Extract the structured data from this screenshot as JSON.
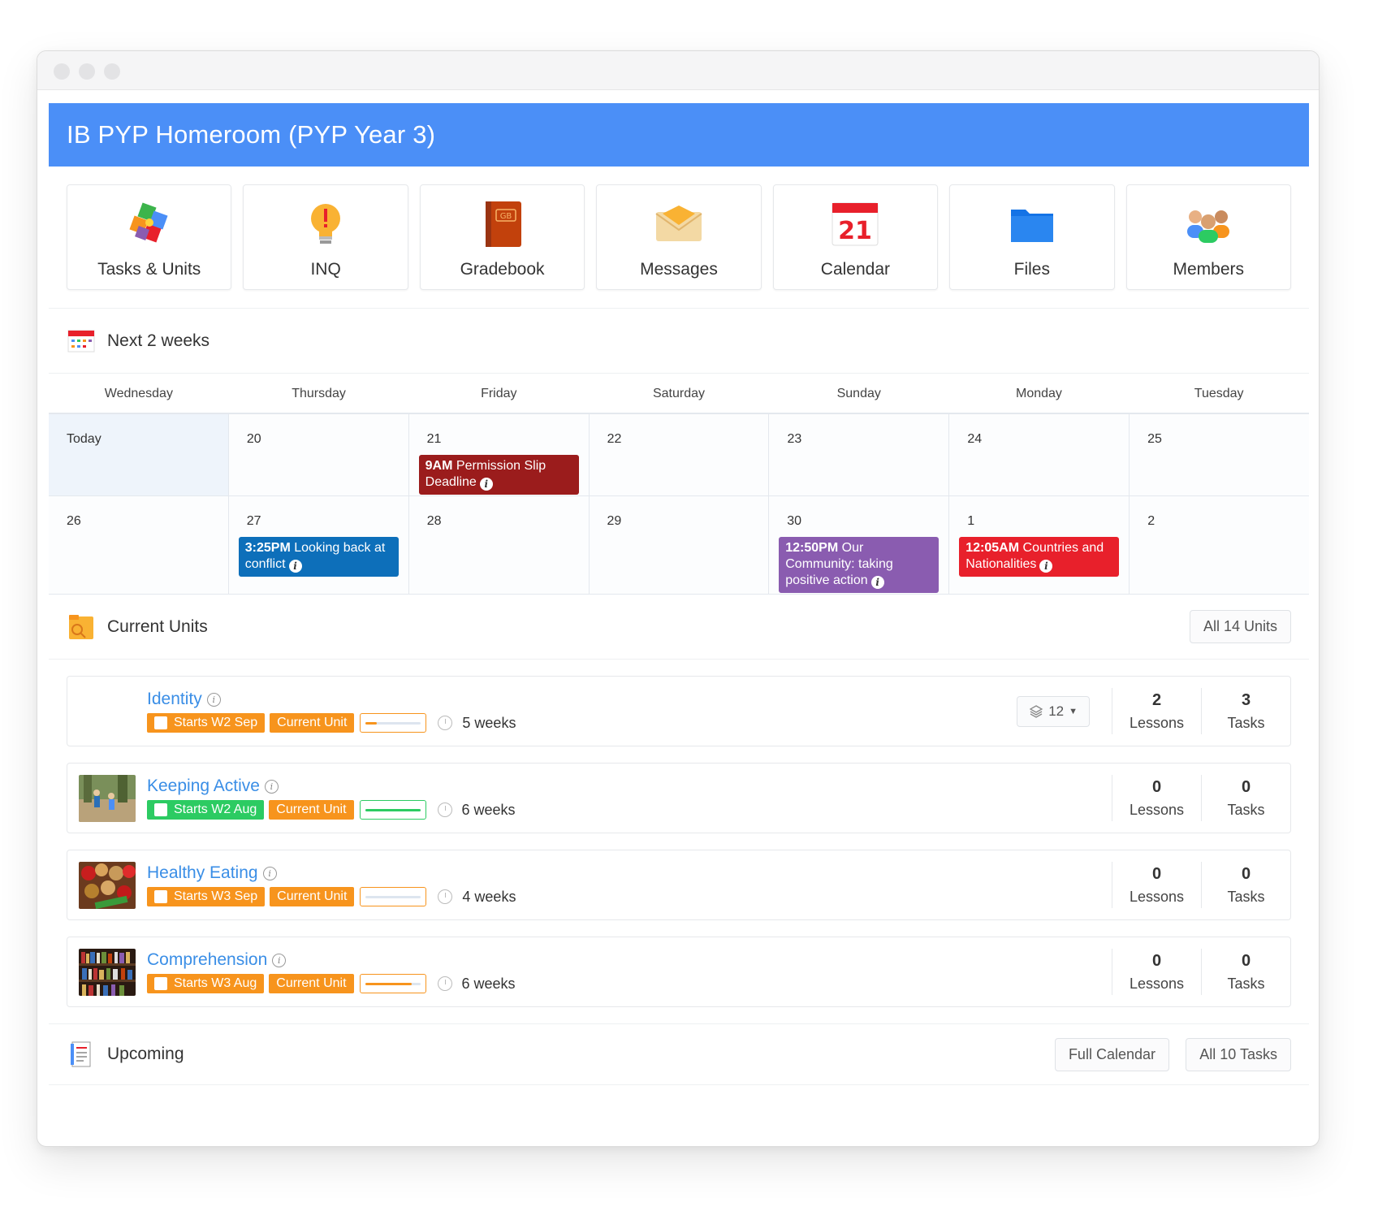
{
  "page": {
    "title": "IB PYP Homeroom (PYP Year 3)"
  },
  "tools": [
    {
      "label": "Tasks & Units",
      "icon": "puzzle-icon"
    },
    {
      "label": "INQ",
      "icon": "lightbulb-icon"
    },
    {
      "label": "Gradebook",
      "icon": "gradebook-icon"
    },
    {
      "label": "Messages",
      "icon": "envelope-icon"
    },
    {
      "label": "Calendar",
      "icon": "calendar-icon"
    },
    {
      "label": "Files",
      "icon": "folder-icon"
    },
    {
      "label": "Members",
      "icon": "members-icon"
    }
  ],
  "calendar_icon_day": "21",
  "next_weeks": {
    "title": "Next 2 weeks",
    "days": [
      "Wednesday",
      "Thursday",
      "Friday",
      "Saturday",
      "Sunday",
      "Monday",
      "Tuesday"
    ],
    "week1": [
      "Today",
      "20",
      "21",
      "22",
      "23",
      "24",
      "25"
    ],
    "week2": [
      "26",
      "27",
      "28",
      "29",
      "30",
      "1",
      "2"
    ],
    "events": {
      "e21": {
        "time": "9AM",
        "text": "Permission Slip Deadline",
        "color": "#9b1c1c"
      },
      "e27": {
        "time": "3:25PM",
        "text": "Looking back at conflict",
        "color": "#0d6fba"
      },
      "e30": {
        "time": "12:50PM",
        "text": "Our Community: taking positive action",
        "color": "#8a5cb0"
      },
      "e1": {
        "time": "12:05AM",
        "text": "Countries and Nationalities",
        "color": "#e8202b"
      }
    }
  },
  "current_units": {
    "title": "Current Units",
    "all_button": "All 14 Units",
    "units": [
      {
        "name": "Identity",
        "starts": "Starts W2 Sep",
        "status": "Current Unit",
        "duration": "5 weeks",
        "progress": 0.2,
        "lessons": "2",
        "tasks": "3",
        "layers": "12",
        "tag_color": "orange"
      },
      {
        "name": "Keeping Active",
        "starts": "Starts W2 Aug",
        "status": "Current Unit",
        "duration": "6 weeks",
        "progress": 1.0,
        "lessons": "0",
        "tasks": "0",
        "tag_color": "green"
      },
      {
        "name": "Healthy Eating",
        "starts": "Starts W3 Sep",
        "status": "Current Unit",
        "duration": "4 weeks",
        "progress": 0.0,
        "lessons": "0",
        "tasks": "0",
        "tag_color": "orange"
      },
      {
        "name": "Comprehension",
        "starts": "Starts W3 Aug",
        "status": "Current Unit",
        "duration": "6 weeks",
        "progress": 0.85,
        "lessons": "0",
        "tasks": "0",
        "tag_color": "orange"
      }
    ],
    "lessons_label": "Lessons",
    "tasks_label": "Tasks"
  },
  "upcoming": {
    "title": "Upcoming",
    "full_calendar_button": "Full Calendar",
    "all_tasks_button": "All 10 Tasks"
  },
  "colors": {
    "banner": "#4b8ff7",
    "link": "#3a8ee6",
    "orange": "#f7941d",
    "green": "#2ccb62"
  }
}
